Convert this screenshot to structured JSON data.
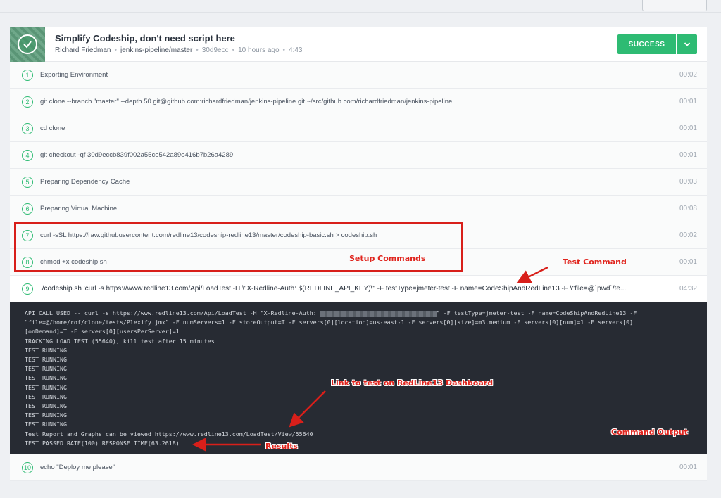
{
  "build": {
    "commit_message": "Simplify Codeship, don't need script here",
    "author": "Richard Friedman",
    "branch": "jenkins-pipeline/master",
    "commit_sha": "30d9ecc",
    "time_ago": "10 hours ago",
    "duration": "4:43",
    "status_label": "SUCCESS"
  },
  "steps": [
    {
      "num": "1",
      "command": "Exporting Environment",
      "time": "00:02"
    },
    {
      "num": "2",
      "command": "git clone --branch \"master\" --depth 50 git@github.com:richardfriedman/jenkins-pipeline.git ~/src/github.com/richardfriedman/jenkins-pipeline",
      "time": "00:01"
    },
    {
      "num": "3",
      "command": "cd clone",
      "time": "00:01"
    },
    {
      "num": "4",
      "command": "git checkout -qf 30d9eccb839f002a55ce542a89e416b7b26a4289",
      "time": "00:01"
    },
    {
      "num": "5",
      "command": "Preparing Dependency Cache",
      "time": "00:03"
    },
    {
      "num": "6",
      "command": "Preparing Virtual Machine",
      "time": "00:08"
    },
    {
      "num": "7",
      "command": "curl -sSL https://raw.githubusercontent.com/redline13/codeship-redline13/master/codeship-basic.sh > codeship.sh",
      "time": "00:02"
    },
    {
      "num": "8",
      "command": "chmod +x codeship.sh",
      "time": "00:01"
    },
    {
      "num": "9",
      "command": "./codeship.sh 'curl -s https://www.redline13.com/Api/LoadTest -H \\\"X-Redline-Auth: $(REDLINE_API_KEY)\\\" -F testType=jmeter-test -F name=CodeShipAndRedLine13 -F \\\"file=@`pwd`/te...",
      "time": "04:32"
    },
    {
      "num": "10",
      "command": "echo \"Deploy me please\"",
      "time": "00:01"
    }
  ],
  "output": {
    "line1_a": "API CALL USED -- curl -s https://www.redline13.com/Api/LoadTest -H \"X-Redline-Auth: ",
    "line1_b": "\" -F testType=jmeter-test -F name=CodeShipAndRedLine13 -F",
    "line2": "\"file=@/home/rof/clone/tests/Plexify.jmx\" -F numServers=1 -F storeOutput=T -F servers[0][location]=us-east-1 -F servers[0][size]=m3.medium -F servers[0][num]=1 -F servers[0]",
    "line3": "[onDemand]=T -F servers[0][usersPerServer]=1",
    "line4": "TRACKING LOAD TEST (55640), kill test after 15 minutes",
    "running": "TEST RUNNING",
    "report": "Test Report and Graphs can be viewed https://www.redline13.com/LoadTest/View/55640",
    "result": "TEST PASSED RATE(100) RESPONSE TIME(63.2618)"
  },
  "annotations": {
    "setup": "Setup Commands",
    "test_command": "Test Command",
    "link": "Link to test on RedLine13 Dashboard",
    "command_output": "Command Output",
    "results": "Results"
  },
  "colors": {
    "success": "#2ebb73",
    "terminal_bg": "#272b33",
    "annotation": "#e0241d"
  }
}
